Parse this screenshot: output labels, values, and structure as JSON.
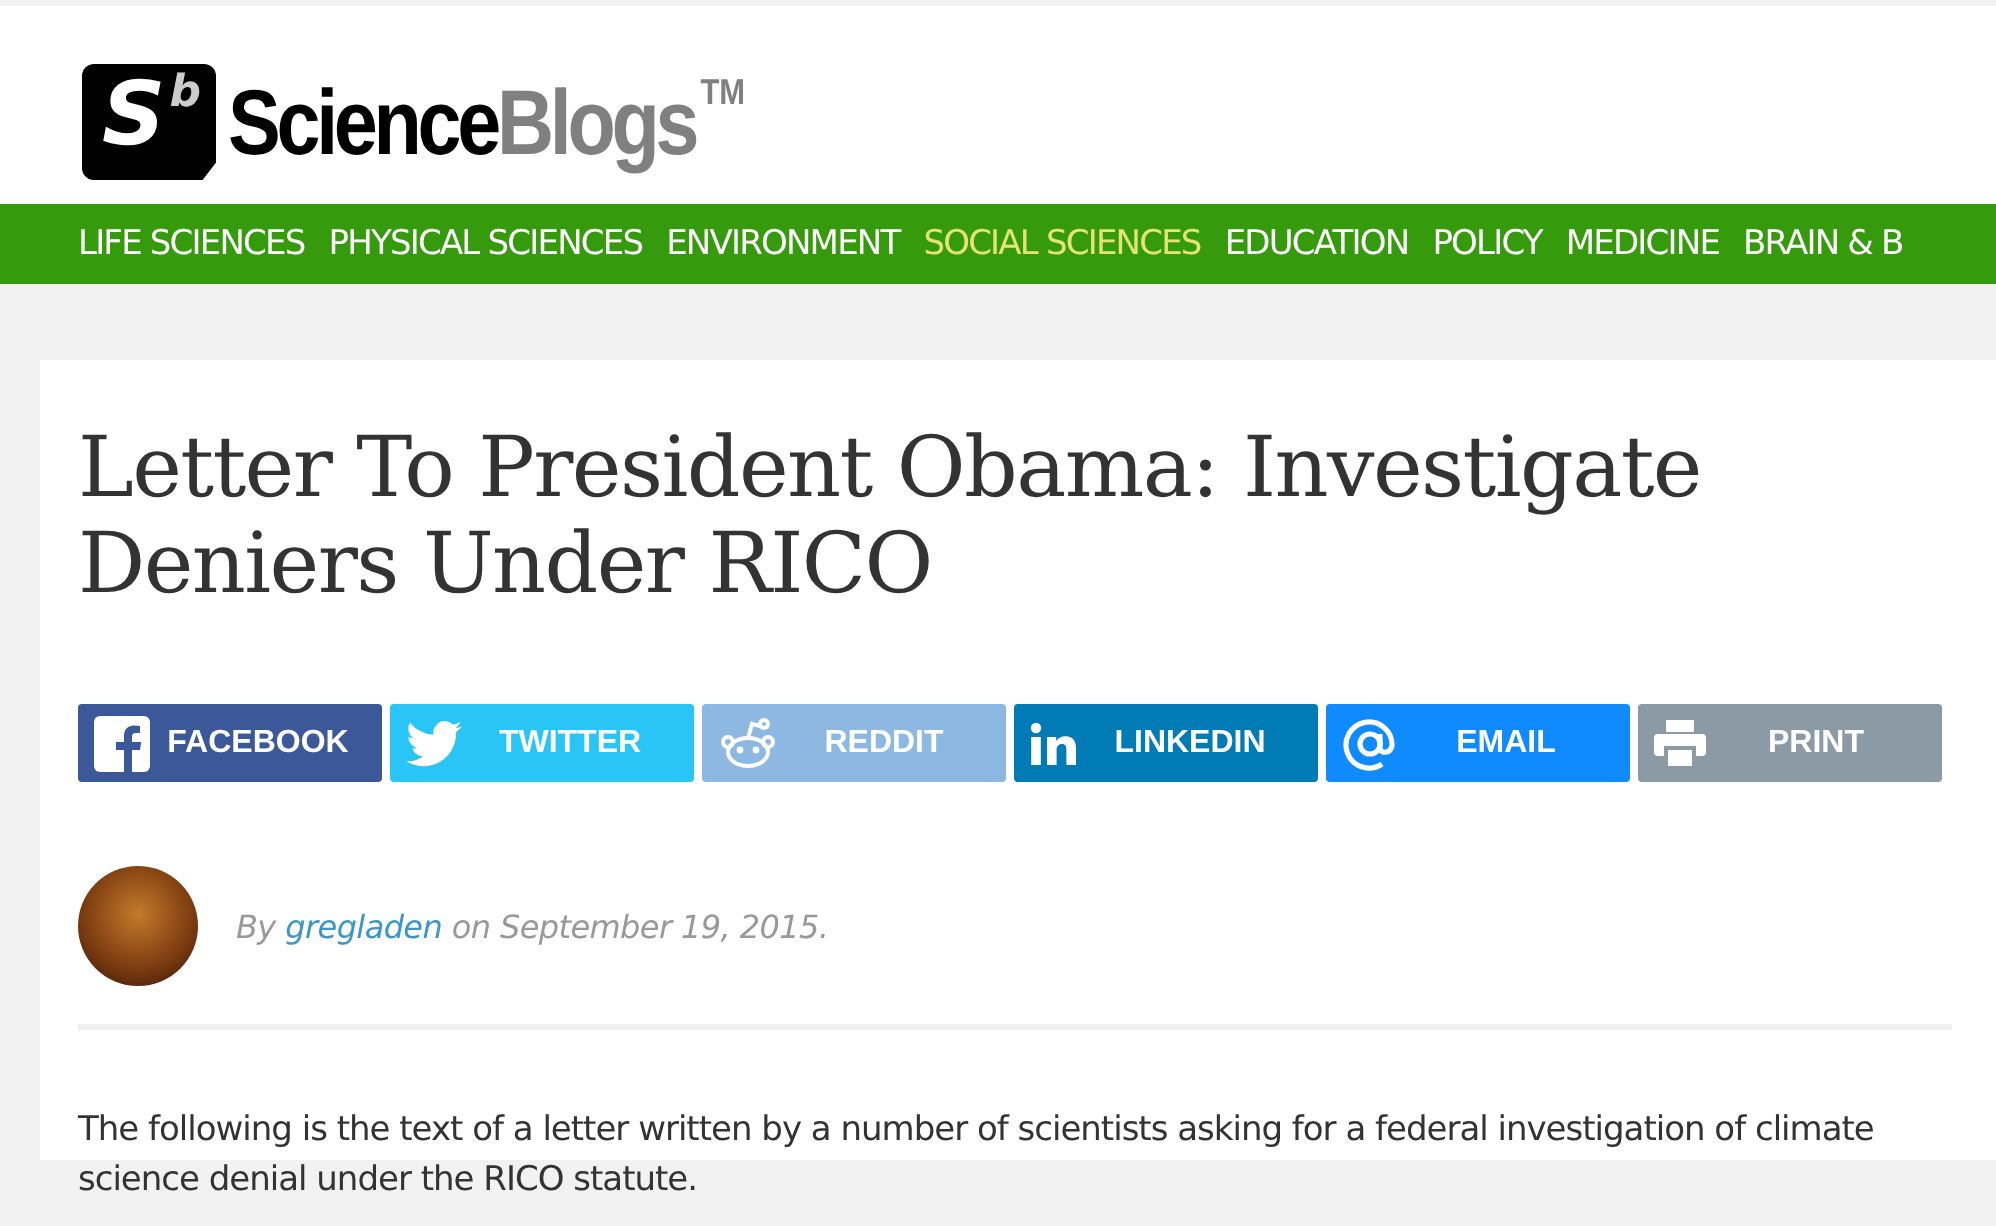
{
  "logo": {
    "mark": "S",
    "mark_sup": "b",
    "word_1": "Science",
    "word_2": "Blogs",
    "trademark": "TM"
  },
  "nav": [
    {
      "label": "LIFE SCIENCES",
      "selected": false
    },
    {
      "label": "PHYSICAL SCIENCES",
      "selected": false
    },
    {
      "label": "ENVIRONMENT",
      "selected": false
    },
    {
      "label": "SOCIAL SCIENCES",
      "selected": true
    },
    {
      "label": "EDUCATION",
      "selected": false
    },
    {
      "label": "POLICY",
      "selected": false
    },
    {
      "label": "MEDICINE",
      "selected": false
    },
    {
      "label": "BRAIN & B",
      "selected": false
    }
  ],
  "article": {
    "title": "Letter To President Obama: Investigate Deniers Under RICO",
    "share": [
      {
        "kind": "facebook",
        "label": "FACEBOOK",
        "color": "#3b5998"
      },
      {
        "kind": "twitter",
        "label": "TWITTER",
        "color": "#29c5f6"
      },
      {
        "kind": "reddit",
        "label": "REDDIT",
        "color": "#8db8e2"
      },
      {
        "kind": "linkedin",
        "label": "LINKEDIN",
        "color": "#007bb6"
      },
      {
        "kind": "email",
        "label": "EMAIL",
        "color": "#0f8bff"
      },
      {
        "kind": "print",
        "label": "PRINT",
        "color": "#8c9aa6"
      }
    ],
    "byline": {
      "prefix": "By",
      "author": "gregladen",
      "suffix": "on September 19, 2015."
    },
    "body": "The following is the text of a letter written by a number of scientists asking for a federal investigation of climate science denial under the RICO statute."
  }
}
